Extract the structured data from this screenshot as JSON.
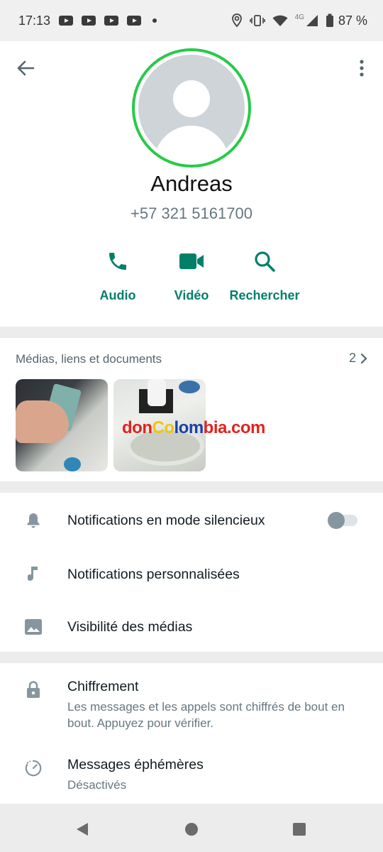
{
  "status_bar": {
    "time": "17:13",
    "network": "4G",
    "battery": "87 %"
  },
  "contact": {
    "name": "Andreas",
    "phone": "+57 321 5161700"
  },
  "actions": {
    "audio": "Audio",
    "video": "Vidéo",
    "search": "Rechercher"
  },
  "media": {
    "title": "Médias, liens et documents",
    "count": "2",
    "watermark": [
      "don",
      "Co",
      "lom",
      "bia.com"
    ]
  },
  "settings": {
    "silent_notifications": "Notifications en mode silencieux",
    "custom_notifications": "Notifications personnalisées",
    "media_visibility": "Visibilité des médias",
    "silent_toggle_on": false
  },
  "privacy": {
    "encryption_title": "Chiffrement",
    "encryption_subtitle": "Les messages et les appels sont chiffrés de bout en bout. Appuyez pour vérifier.",
    "ephemeral_title": "Messages éphémères",
    "ephemeral_subtitle": "Désactivés"
  },
  "colors": {
    "accent": "#008069",
    "ring": "#29c94a",
    "icon_grey": "#8696a0"
  },
  "icons": [
    "back-arrow-icon",
    "more-vert-icon",
    "phone-icon",
    "video-camera-icon",
    "search-icon",
    "bell-icon",
    "music-note-icon",
    "image-icon",
    "lock-icon",
    "timer-icon"
  ]
}
